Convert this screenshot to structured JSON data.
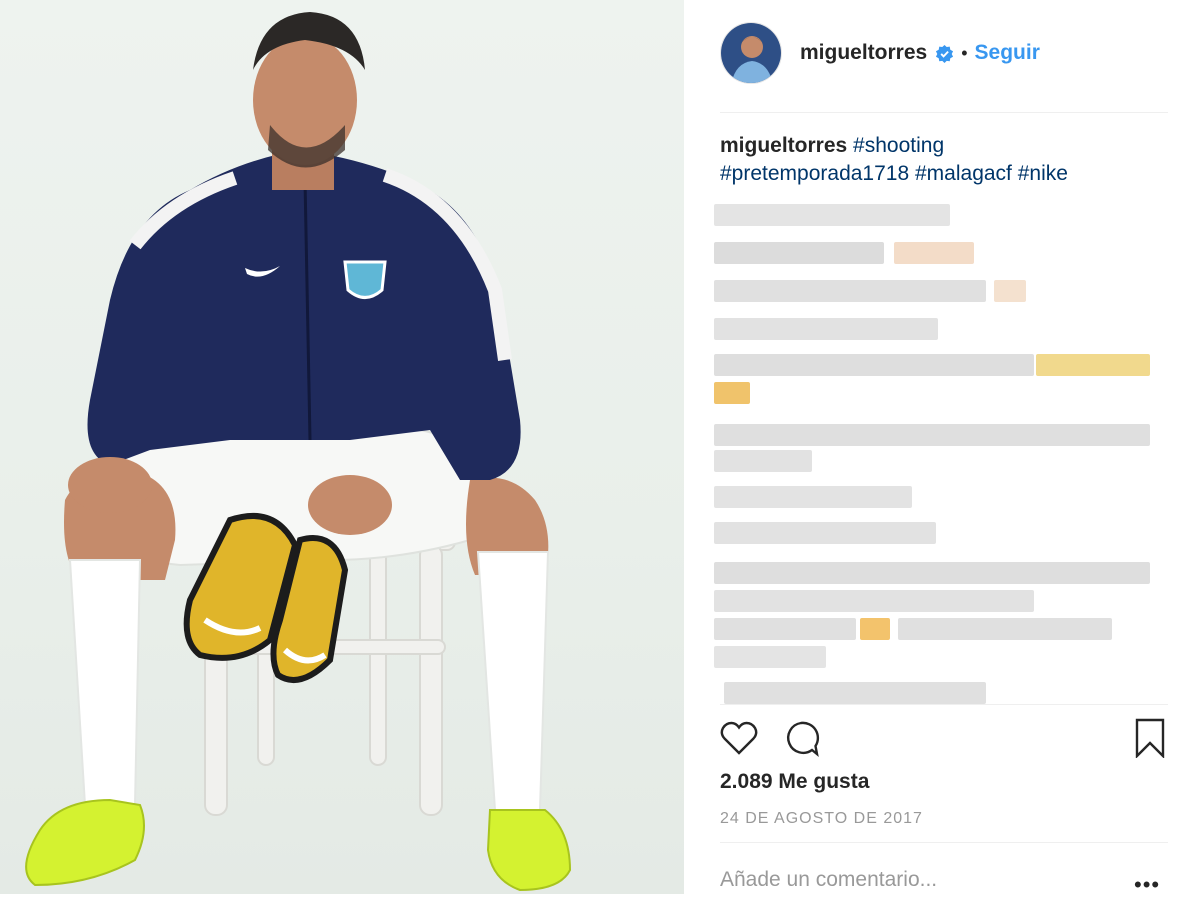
{
  "post": {
    "username": "migueltorres",
    "follow_label": "Seguir",
    "caption": {
      "username": "migueltorres",
      "tags_line1": [
        "#shooting"
      ],
      "tags_line2": [
        "#pretemporada1718",
        "#malagacf",
        "#nike"
      ]
    },
    "likes": "2.089 Me gusta",
    "date": "24 DE AGOSTO DE 2017",
    "comment_placeholder": "Añade un comentario...",
    "more_label": "•••"
  },
  "colors": {
    "link": "#3897f0",
    "hashtag": "#003569",
    "jacket": "#1f2a5c",
    "boot_yellow": "#e0b52a",
    "boot_neon": "#d4f230"
  },
  "icons": [
    "verified-icon",
    "heart-icon",
    "comment-icon",
    "bookmark-icon"
  ]
}
